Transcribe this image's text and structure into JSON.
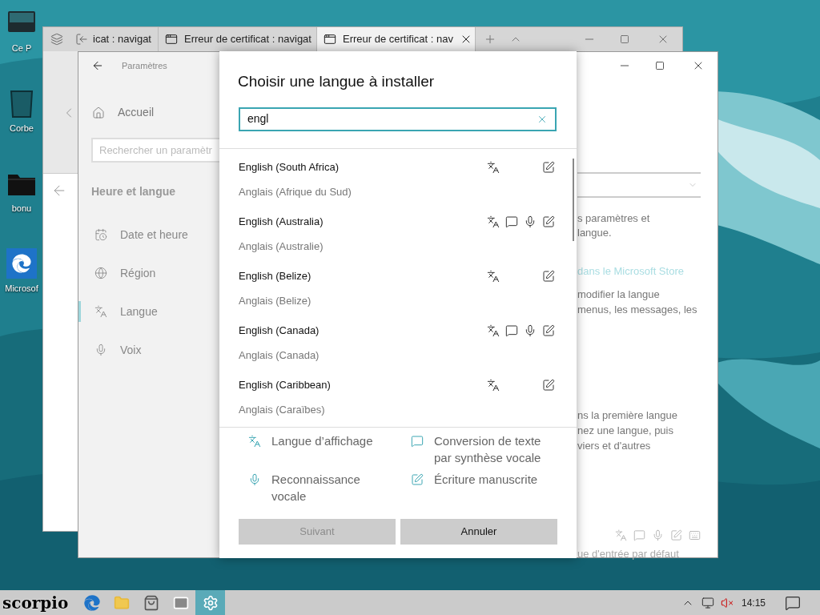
{
  "desktop_icons": [
    {
      "kind": "computer",
      "label": "Ce P"
    },
    {
      "kind": "bin",
      "label": "Corbe"
    },
    {
      "kind": "folder",
      "label": "bonu"
    },
    {
      "kind": "browser",
      "label": "Microsof"
    }
  ],
  "browser": {
    "tabs": [
      {
        "title": "icat : navigat",
        "selected": false
      },
      {
        "title": "Erreur de certificat : navigat",
        "selected": false
      },
      {
        "title": "Erreur de certificat : nav",
        "selected": true
      }
    ]
  },
  "settings": {
    "title": "Paramètres",
    "home": "Accueil",
    "search_placeholder": "Rechercher un paramètr",
    "section": "Heure et langue",
    "nav": [
      {
        "kind": "clock",
        "label": "Date et heure",
        "selected": false
      },
      {
        "kind": "globe",
        "label": "Région",
        "selected": false
      },
      {
        "kind": "language",
        "label": "Langue",
        "selected": true
      },
      {
        "kind": "mic",
        "label": "Voix",
        "selected": false
      }
    ],
    "text_top": [
      "s paramètres et",
      "langue."
    ],
    "link": "dans le Microsoft Store",
    "text_mid": [
      "modifier la langue",
      "menus, les messages, les"
    ],
    "text_low": [
      "ns la première langue",
      "nez une langue, puis",
      "viers et d'autres"
    ],
    "footer": "ue d'entrée par défaut"
  },
  "dialog": {
    "title": "Choisir une langue à installer",
    "search": {
      "value": "engl"
    },
    "languages": [
      {
        "name": "English (South Africa)",
        "native": "Anglais (Afrique du Sud)",
        "display": true,
        "tts": false,
        "speech": false,
        "handwriting": true
      },
      {
        "name": "English (Australia)",
        "native": "Anglais (Australie)",
        "display": true,
        "tts": true,
        "speech": true,
        "handwriting": true
      },
      {
        "name": "English (Belize)",
        "native": "Anglais (Belize)",
        "display": true,
        "tts": false,
        "speech": false,
        "handwriting": true
      },
      {
        "name": "English (Canada)",
        "native": "Anglais (Canada)",
        "display": true,
        "tts": true,
        "speech": true,
        "handwriting": true
      },
      {
        "name": "English (Caribbean)",
        "native": "Anglais (Caraïbes)",
        "display": true,
        "tts": false,
        "speech": false,
        "handwriting": true
      }
    ],
    "legend": [
      {
        "kind": "display",
        "label": "Langue d’affichage"
      },
      {
        "kind": "tts",
        "label": "Conversion de texte par synthèse vocale"
      },
      {
        "kind": "speech",
        "label": "Reconnaissance vocale"
      },
      {
        "kind": "handwriting",
        "label": "Écriture manuscrite"
      }
    ],
    "buttons": [
      {
        "label": "Suivant",
        "disabled": true
      },
      {
        "label": "Annuler",
        "disabled": false
      }
    ]
  },
  "taskbar": {
    "logo": "scorpio",
    "apps": [
      {
        "kind": "browser",
        "selected": false
      },
      {
        "kind": "folder",
        "selected": false
      },
      {
        "kind": "store",
        "selected": false
      },
      {
        "kind": "mail",
        "selected": false
      },
      {
        "kind": "settings",
        "selected": true
      }
    ],
    "time": "14:15"
  }
}
